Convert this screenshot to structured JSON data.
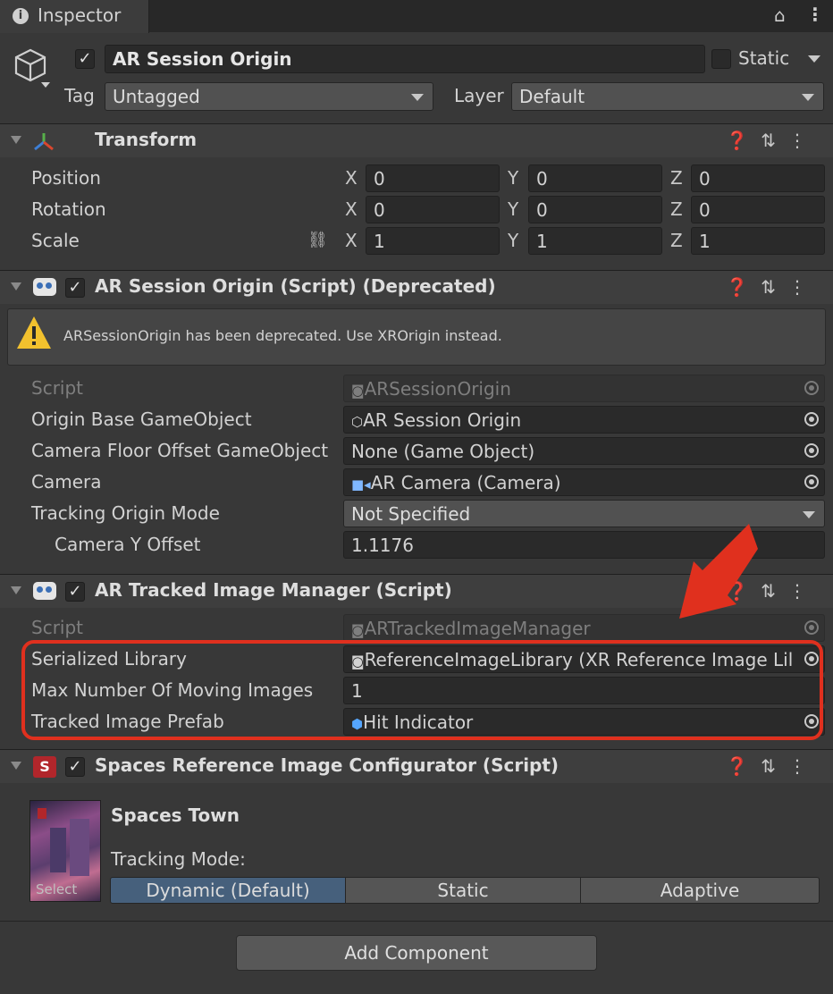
{
  "tab": {
    "title": "Inspector"
  },
  "object": {
    "name": "AR Session Origin",
    "static_label": "Static",
    "tag_label": "Tag",
    "tag_value": "Untagged",
    "layer_label": "Layer",
    "layer_value": "Default"
  },
  "transform": {
    "title": "Transform",
    "rows": [
      {
        "label": "Position",
        "x": "0",
        "y": "0",
        "z": "0"
      },
      {
        "label": "Rotation",
        "x": "0",
        "y": "0",
        "z": "0"
      },
      {
        "label": "Scale",
        "x": "1",
        "y": "1",
        "z": "1"
      }
    ],
    "axis": {
      "x": "X",
      "y": "Y",
      "z": "Z"
    }
  },
  "session_origin": {
    "title": "AR Session Origin (Script) (Deprecated)",
    "warning": "ARSessionOrigin has been deprecated. Use XROrigin instead.",
    "fields": {
      "script_label": "Script",
      "script_value": "ARSessionOrigin",
      "origin_label": "Origin Base GameObject",
      "origin_value": "AR Session Origin",
      "floor_label": "Camera Floor Offset GameObject",
      "floor_value": "None (Game Object)",
      "camera_label": "Camera",
      "camera_value": "AR Camera (Camera)",
      "tracking_label": "Tracking Origin Mode",
      "tracking_value": "Not Specified",
      "offset_label": "Camera Y Offset",
      "offset_value": "1.1176"
    }
  },
  "tracked_image_manager": {
    "title": "AR Tracked Image Manager (Script)",
    "script_label": "Script",
    "script_value": "ARTrackedImageManager",
    "library_label": "Serialized Library",
    "library_value": "ReferenceImageLibrary (XR Reference Image Lil",
    "max_label": "Max Number Of Moving Images",
    "max_value": "1",
    "prefab_label": "Tracked Image Prefab",
    "prefab_value": "Hit Indicator"
  },
  "spaces_configurator": {
    "title": "Spaces Reference Image Configurator (Script)",
    "image_name": "Spaces Town",
    "thumb_select": "Select",
    "tracking_mode_label": "Tracking Mode:",
    "modes": [
      "Dynamic (Default)",
      "Static",
      "Adaptive"
    ],
    "selected_mode": "Dynamic (Default)"
  },
  "add_component": "Add Component",
  "colors": {
    "background": "#383838",
    "header": "#3e3e3e",
    "selected_segment": "#46607c",
    "highlight": "#e0301e",
    "warning_icon": "#f2c12e"
  }
}
